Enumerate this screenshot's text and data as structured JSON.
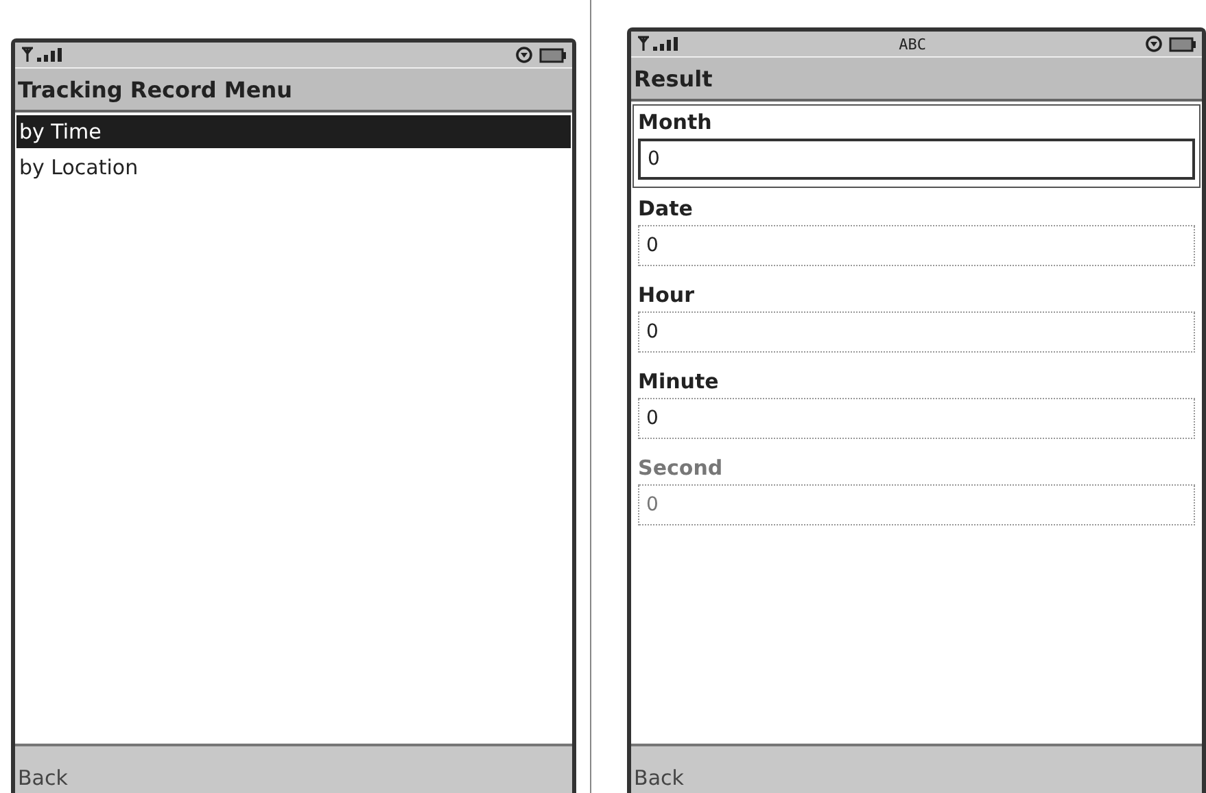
{
  "screens": [
    {
      "kind": "menu",
      "title": "Tracking Record Menu",
      "items": [
        {
          "label": "by Time",
          "selected": true
        },
        {
          "label": "by Location",
          "selected": false
        }
      ],
      "softkey": "Back"
    },
    {
      "kind": "form",
      "input_mode": "ABC",
      "title": "Result",
      "fields": [
        {
          "label": "Month",
          "value": "0",
          "focused": true,
          "disabled": false
        },
        {
          "label": "Date",
          "value": "0",
          "focused": false,
          "disabled": false
        },
        {
          "label": "Hour",
          "value": "0",
          "focused": false,
          "disabled": false
        },
        {
          "label": "Minute",
          "value": "0",
          "focused": false,
          "disabled": false
        },
        {
          "label": "Second",
          "value": "0",
          "focused": false,
          "disabled": true
        }
      ],
      "softkey": "Back"
    }
  ]
}
